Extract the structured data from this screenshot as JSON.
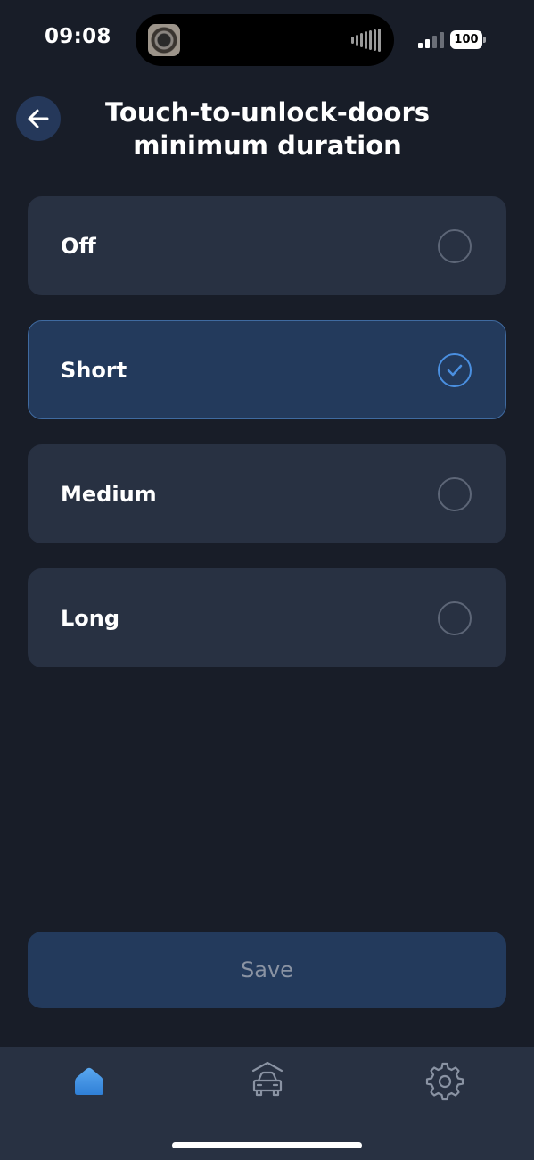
{
  "status_bar": {
    "time": "09:08",
    "battery": "100"
  },
  "header": {
    "title_line1": "Touch-to-unlock-doors",
    "title_line2": "minimum duration",
    "back_icon": "arrow-left-icon"
  },
  "options": [
    {
      "label": "Off",
      "selected": false
    },
    {
      "label": "Short",
      "selected": true
    },
    {
      "label": "Medium",
      "selected": false
    },
    {
      "label": "Long",
      "selected": false
    }
  ],
  "save_button": {
    "label": "Save"
  },
  "bottom_nav": {
    "items": [
      {
        "icon": "home-icon",
        "active": true
      },
      {
        "icon": "car-garage-icon",
        "active": false
      },
      {
        "icon": "gear-icon",
        "active": false
      }
    ]
  },
  "colors": {
    "background": "#181d28",
    "card": "#283142",
    "selected_card": "#233a5c",
    "accent": "#4a8fe0"
  }
}
